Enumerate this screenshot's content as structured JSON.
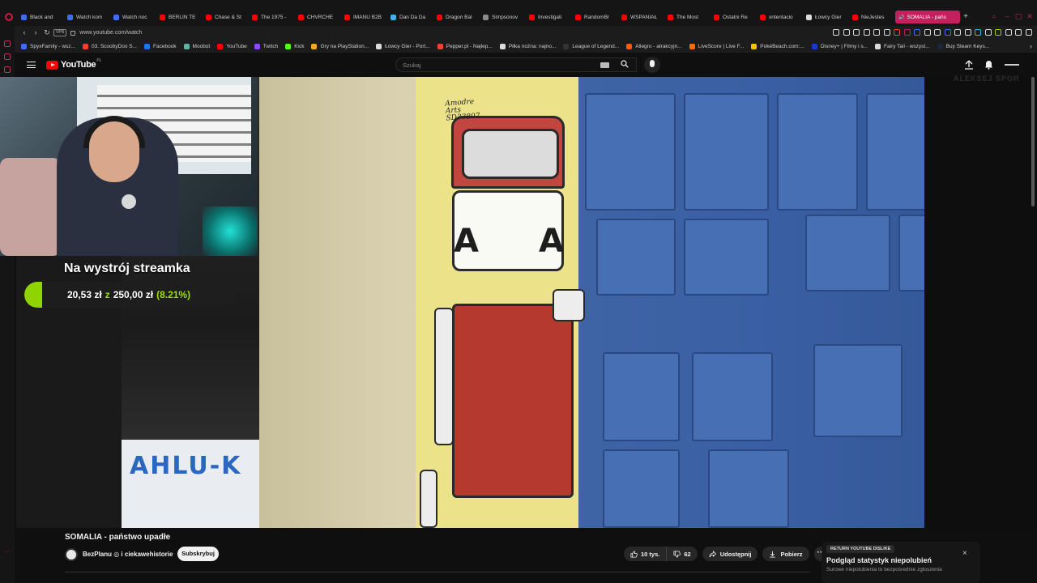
{
  "browser": {
    "tabs": [
      {
        "label": "Black and",
        "color": "#3b6ef5"
      },
      {
        "label": "Watch kom",
        "color": "#3b6ef5"
      },
      {
        "label": "Watch noc",
        "color": "#3b6ef5"
      },
      {
        "label": "BERLIN TE",
        "color": "#ff0000"
      },
      {
        "label": "Chase & St",
        "color": "#ff0000"
      },
      {
        "label": "The 1975 -",
        "color": "#ff0000"
      },
      {
        "label": "CHVRCHE",
        "color": "#ff0000"
      },
      {
        "label": "IMANU B2B",
        "color": "#ff0000"
      },
      {
        "label": "Dan Da Da",
        "color": "#3bb3f5"
      },
      {
        "label": "Dragon Bal",
        "color": "#ff0000"
      },
      {
        "label": "Simpsonov",
        "color": "#8b8b8b"
      },
      {
        "label": "Investigati",
        "color": "#ff0000"
      },
      {
        "label": "RandomBr",
        "color": "#ff0000"
      },
      {
        "label": "WSPANIAŁ",
        "color": "#ff0000"
      },
      {
        "label": "The Most",
        "color": "#ff0000"
      },
      {
        "label": "Ostatni Re",
        "color": "#ff0000"
      },
      {
        "label": "xntentacio",
        "color": "#ff0000"
      },
      {
        "label": "Łowcy Gier",
        "color": "#dddddd"
      },
      {
        "label": "NieJestes",
        "color": "#ff0000"
      }
    ],
    "active_tab": {
      "label": "SOMALIA - pańs",
      "color": "#c4205e"
    },
    "url": "www.youtube.com/watch",
    "vpn_label": "VPN",
    "bookmarks": [
      {
        "label": "SpyxFamily - wsz...",
        "color": "#3b6ef5"
      },
      {
        "label": "03. ScoobyDoo S...",
        "color": "#e8452c"
      },
      {
        "label": "Facebook",
        "color": "#1877f2"
      },
      {
        "label": "Moobot",
        "color": "#5fb3a5"
      },
      {
        "label": "YouTube",
        "color": "#ff0000"
      },
      {
        "label": "Twitch",
        "color": "#9146ff"
      },
      {
        "label": "Kick",
        "color": "#53fc18"
      },
      {
        "label": "Gry na PlayStation...",
        "color": "#f5a623"
      },
      {
        "label": "Łowcy Gier - Port...",
        "color": "#dddddd"
      },
      {
        "label": "Pepper.pl - Najlep...",
        "color": "#e8452c"
      },
      {
        "label": "Piłka nożna: najno...",
        "color": "#dddddd"
      },
      {
        "label": "League of Legend...",
        "color": "#333333"
      },
      {
        "label": "Allegro - atrakcyjn...",
        "color": "#ff5a00"
      },
      {
        "label": "LiveScore | Live F...",
        "color": "#ff6a00"
      },
      {
        "label": "PokéBeach.com:...",
        "color": "#f5c400"
      },
      {
        "label": "Disney+ | Filmy i s...",
        "color": "#113ccf"
      },
      {
        "label": "Fairy Tail - wszyst...",
        "color": "#dddddd"
      },
      {
        "label": "Buy Steam Keys...",
        "color": "#1b2838"
      }
    ]
  },
  "youtube": {
    "logo_text": "YouTube",
    "logo_region": "PL",
    "search_placeholder": "Szukaj",
    "watermark": "ALEKSEJ SPOR"
  },
  "scene": {
    "sign_text": "AHLU-K",
    "tuk_label_line1": "Amodre",
    "tuk_label_line2": "Arts",
    "tuk_label_line3": "SD33807",
    "tuk_letter_left": "A",
    "tuk_letter_right": "A"
  },
  "goal": {
    "title": "Na wystrój streamka",
    "current": "20,53 zł",
    "of": "z",
    "target": "250,00 zł",
    "percent": "(8.21%)",
    "fraction": 0.0821,
    "fill_color": "#8fd400"
  },
  "video": {
    "title": "SOMALIA - państwo upadłe",
    "channel": "BezPlanu ◎ i ciekawehistorie",
    "subscribe_label": "Subskrybuj",
    "likes": "10 tys.",
    "dislikes": "62",
    "share_label": "Udostępnij",
    "download_label": "Pobierz",
    "more_label": "···"
  },
  "dislike_popup": {
    "tag": "RETURN YOUTUBE DISLIKE",
    "title": "Podgląd statystyk niepolubień",
    "subtitle": "Surowe niepolubienia to bezpośrednie zgłoszenia",
    "close": "×"
  },
  "colors": {
    "accent": "#c4205e",
    "yt_red": "#ff0000",
    "background": "#0f0f0f"
  }
}
